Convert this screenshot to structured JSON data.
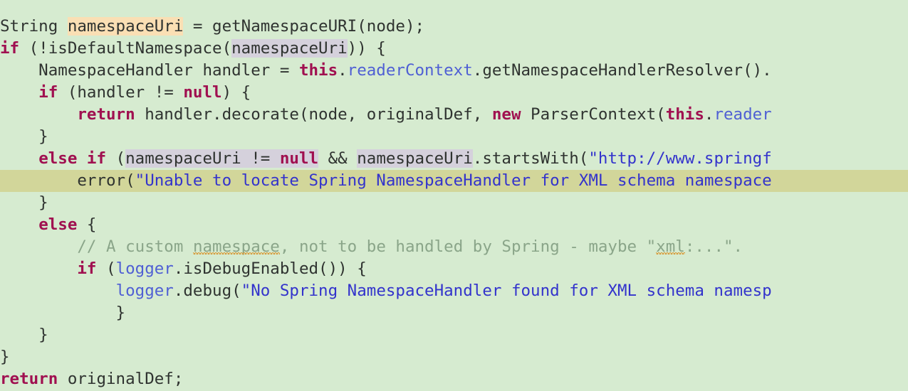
{
  "editor": {
    "background_color": "#d6ebd0",
    "current_line_color": "#d2d69a",
    "occurrence_write_color": "#fadfb4",
    "occurrence_read_color": "#d5d1dc",
    "keyword_color": "#a01050",
    "string_color": "#3333cc",
    "field_color": "#4f5fd4",
    "comment_color": "#8aa589",
    "spellcheck_underline_color": "#d79c3c",
    "language": "Java"
  },
  "lines": {
    "l1": {
      "t1": "String ",
      "t2": "namespaceUri",
      "t3": " = getNamespaceURI(node);"
    },
    "l2": {
      "t1": "if",
      "t2": " (!isDefaultNamespace(",
      "t3": "namespaceUri",
      "t4": ")) {"
    },
    "l3": {
      "t1": "    NamespaceHandler handler = ",
      "t2": "this",
      "t3": ".",
      "t4": "readerContext",
      "t5": ".getNamespaceHandlerResolver()."
    },
    "l4": {
      "t1": "    ",
      "t2": "if",
      "t3": " (handler != ",
      "t4": "null",
      "t5": ") {"
    },
    "l5": {
      "t1": "        ",
      "t2": "return",
      "t3": " handler.decorate(node, originalDef, ",
      "t4": "new",
      "t5": " ParserContext(",
      "t6": "this",
      "t7": ".",
      "t8": "reader"
    },
    "l6": {
      "t1": "    }"
    },
    "l7": {
      "t1": "    ",
      "t2": "else if",
      "t3": " (",
      "t4": "namespaceUri",
      "t5": " != ",
      "t6": "null",
      "t7": " && ",
      "t8": "namespaceUri",
      "t9": ".startsWith(",
      "t10": "\"http://www.springf"
    },
    "l8": {
      "t1": "        error(",
      "t2": "\"Unable to locate Spring NamespaceHandler for XML schema namespace"
    },
    "l9": {
      "t1": "    }"
    },
    "l10": {
      "t1": "    ",
      "t2": "else",
      "t3": " {"
    },
    "l11": {
      "t1": "        // A custom ",
      "t2": "namespace",
      "t3": ", not to be handled by Spring - maybe \"",
      "t4": "xml",
      "t5": ":...\"."
    },
    "l12": {
      "t1": "        ",
      "t2": "if",
      "t3": " (",
      "t4": "logger",
      "t5": ".isDebugEnabled()) {"
    },
    "l13": {
      "t1": "            ",
      "t2": "logger",
      "t3": ".debug(",
      "t4": "\"No Spring NamespaceHandler found for XML schema namesp"
    },
    "l14": {
      "t1": "            }"
    },
    "l15": {
      "t1": "    }"
    },
    "l16": {
      "t1": "}"
    },
    "l17": {
      "t1": "return",
      "t2": " originalDef;"
    }
  }
}
